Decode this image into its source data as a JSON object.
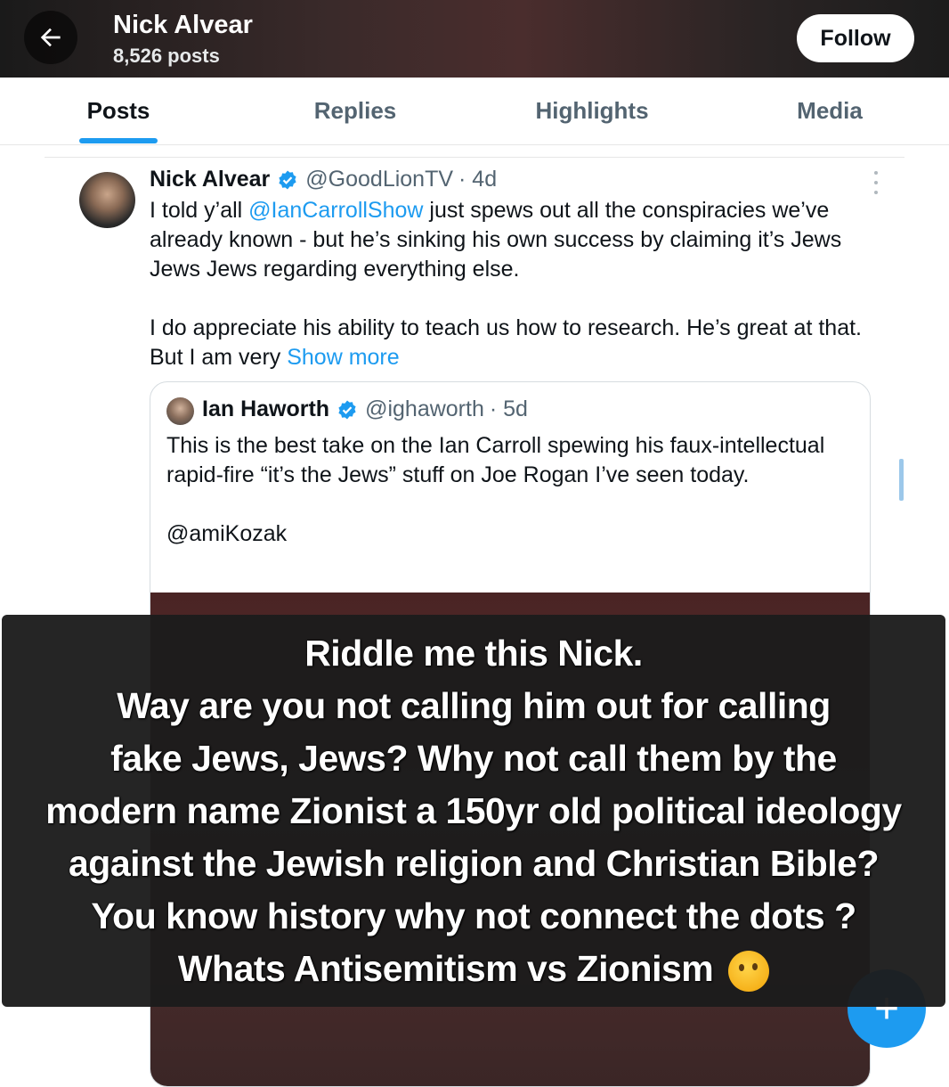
{
  "header": {
    "title": "Nick Alvear",
    "posts_count": "8,526 posts",
    "follow_label": "Follow"
  },
  "tabs": [
    {
      "label": "Posts",
      "active": true
    },
    {
      "label": "Replies",
      "active": false
    },
    {
      "label": "Highlights",
      "active": false
    },
    {
      "label": "Media",
      "active": false
    }
  ],
  "post": {
    "author_name": "Nick Alvear",
    "handle": "@GoodLionTV",
    "time": "· 4d",
    "text_prefix": "I told y’all ",
    "mention": "@IanCarrollShow",
    "text_after_mention": " just spews out all the conspiracies we’ve already known - but he’s sinking his own success by claiming it’s Jews Jews Jews regarding everything else.",
    "text_para2": "I do appreciate his ability to teach us how to research. He’s great at that. But I am very ",
    "show_more": "Show more"
  },
  "quote": {
    "author_name": "Ian Haworth",
    "handle": "@ighaworth",
    "time": "· 5d",
    "text": "This is the best take on the Ian Carroll spewing his faux-intellectual rapid-fire “it’s the Jews” stuff on Joe Rogan I’ve seen today.",
    "mention": "@amiKozak"
  },
  "overlay": {
    "lines": [
      "Riddle me this  Nick.",
      "Way are you not calling him out for  calling",
      "fake Jews, Jews? Why not call them by the",
      "modern name Zionist a 150yr old political ideology",
      "against the Jewish religion and Christian Bible?",
      "You know history why not connect the dots ?",
      "Whats Antisemitism vs Zionism"
    ],
    "emoji": "thinking-face-emoji"
  },
  "fab": {
    "icon": "plus-icon"
  },
  "colors": {
    "accent": "#1d9bf0",
    "text": "#0f1419",
    "muted": "#536471"
  }
}
